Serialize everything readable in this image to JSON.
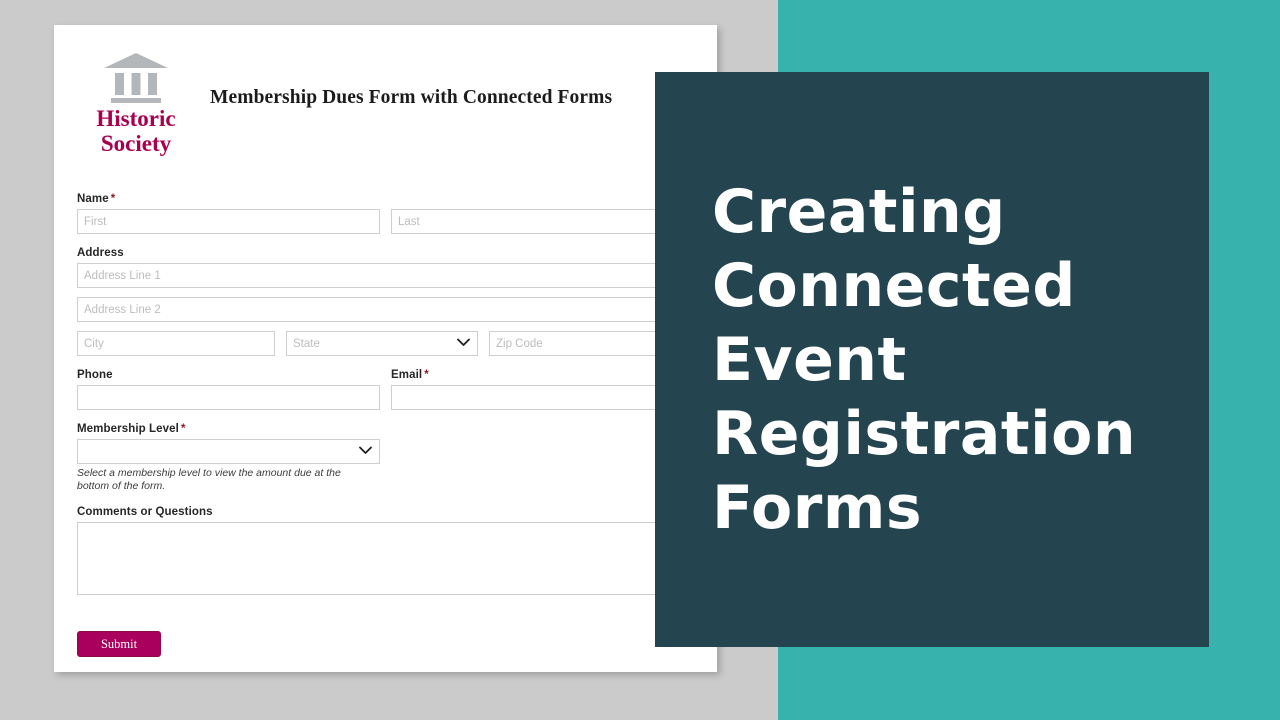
{
  "slide": {
    "background_left_color": "#cbcbcb",
    "background_right_color": "#38b2ad",
    "overlay_panel_color": "#24454f",
    "accent_color": "#a8005c"
  },
  "overlay": {
    "title": "Creating Connected Event Registration Forms"
  },
  "form": {
    "logo": {
      "icon": "classical-building-icon",
      "line1": "Historic",
      "line2": "Society",
      "color": "#a8004f"
    },
    "title": "Membership Dues Form with Connected Forms",
    "fields": {
      "name": {
        "label": "Name",
        "required": "*",
        "first_placeholder": "First",
        "last_placeholder": "Last",
        "first_value": "",
        "last_value": ""
      },
      "address": {
        "label": "Address",
        "line1_placeholder": "Address Line 1",
        "line2_placeholder": "Address Line 2",
        "city_placeholder": "City",
        "state_placeholder": "State",
        "zip_placeholder": "Zip Code",
        "line1_value": "",
        "line2_value": "",
        "city_value": "",
        "state_value": "",
        "zip_value": "",
        "state_options": [
          "State"
        ]
      },
      "phone": {
        "label": "Phone",
        "placeholder": "",
        "value": ""
      },
      "email": {
        "label": "Email",
        "required": "*",
        "placeholder": "",
        "value": ""
      },
      "membership_level": {
        "label": "Membership Level",
        "required": "*",
        "value": "",
        "options": [
          ""
        ],
        "hint": "Select a membership level to view the amount due at the bottom of the form."
      },
      "comments": {
        "label": "Comments or Questions",
        "placeholder": "",
        "value": ""
      }
    },
    "submit_label": "Submit"
  }
}
